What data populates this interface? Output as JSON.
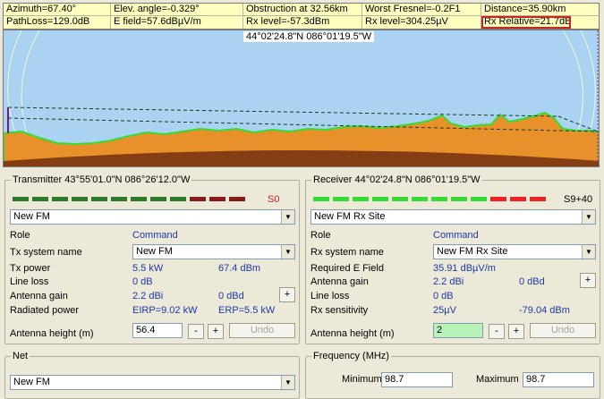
{
  "info": {
    "azimuth": "Azimuth=67.40°",
    "elev_angle": "Elev. angle=-0.329°",
    "obstruction": "Obstruction at 32.56km",
    "worst_fresnel": "Worst Fresnel=-0.2F1",
    "distance": "Distance=35.90km",
    "path_loss": "PathLoss=129.0dB",
    "e_field": "E field=57.6dBµV/m",
    "rx_level_db": "Rx level=-57.3dBm",
    "rx_level_uv": "Rx level=304.25µV",
    "rx_relative": "Rx Relative=21.7dB"
  },
  "profile": {
    "coord_label": "44°02'24.8\"N 086°01'19.5\"W"
  },
  "transmitter": {
    "title": "Transmitter 43°55'01.0\"N 086°26'12.0\"W",
    "meter_value": "S0",
    "system_select": "New FM",
    "role_label": "Role",
    "role_value": "Command",
    "tx_system_label": "Tx system name",
    "tx_system_value": "New FM",
    "tx_power_label": "Tx power",
    "tx_power_kw": "5.5 kW",
    "tx_power_dbm": "67.4 dBm",
    "line_loss_label": "Line loss",
    "line_loss_value": "0 dB",
    "antenna_gain_label": "Antenna gain",
    "antenna_gain_dbi": "2.2 dBi",
    "antenna_gain_dbd": "0 dBd",
    "radiated_power_label": "Radiated power",
    "eirp": "EIRP=9.02 kW",
    "erp": "ERP=5.5 kW",
    "antenna_height_label": "Antenna height (m)",
    "antenna_height_value": "56.4",
    "minus": "-",
    "plus": "+",
    "undo": "Undo"
  },
  "receiver": {
    "title": "Receiver 44°02'24.8\"N 086°01'19.5\"W",
    "meter_value": "S9+40",
    "system_select": "New FM Rx Site",
    "role_label": "Role",
    "role_value": "Command",
    "rx_system_label": "Rx system name",
    "rx_system_value": "New FM Rx Site",
    "required_field_label": "Required E Field",
    "required_field_value": "35.91 dBµV/m",
    "antenna_gain_label": "Antenna gain",
    "antenna_gain_dbi": "2.2 dBi",
    "antenna_gain_dbd": "0 dBd",
    "line_loss_label": "Line loss",
    "line_loss_value": "0 dB",
    "rx_sensitivity_label": "Rx sensitivity",
    "rx_sensitivity_uv": "25µV",
    "rx_sensitivity_dbm": "-79.04 dBm",
    "antenna_height_label": "Antenna height (m)",
    "antenna_height_value": "2",
    "minus": "-",
    "plus": "+",
    "undo": "Undo"
  },
  "net": {
    "title": "Net",
    "select": "New FM"
  },
  "frequency": {
    "title": "Frequency (MHz)",
    "min_label": "Minimum",
    "min_value": "98.7",
    "max_label": "Maximum",
    "max_value": "98.7"
  },
  "colors": {
    "tx_meter": [
      "#2a7a2a",
      "#2a7a2a",
      "#2a7a2a",
      "#2a7a2a",
      "#2a7a2a",
      "#2a7a2a",
      "#2a7a2a",
      "#2a7a2a",
      "#2a7a2a",
      "#8a1a1a",
      "#8a1a1a",
      "#8a1a1a"
    ],
    "rx_meter": [
      "#33dd33",
      "#33dd33",
      "#33dd33",
      "#33dd33",
      "#33dd33",
      "#33dd33",
      "#33dd33",
      "#33dd33",
      "#33dd33",
      "#ee2222",
      "#ee2222",
      "#ee2222"
    ],
    "terrain": "#e8912a",
    "terrain_edge": "#33dd33",
    "sky": "#a9d3f0"
  }
}
